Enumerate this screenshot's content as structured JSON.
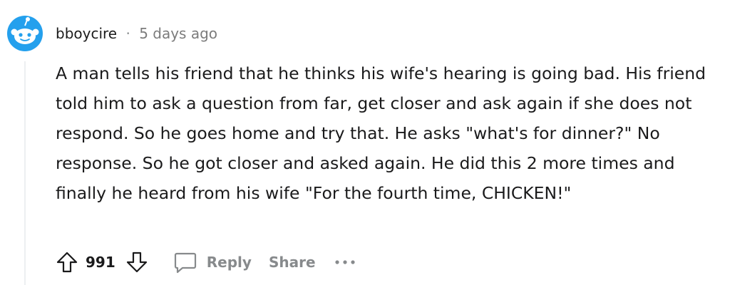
{
  "comment": {
    "author": "bboycire",
    "separator": "·",
    "time_ago": "5 days ago",
    "body": "A man tells his friend that he thinks his wife's hearing is going bad. His friend told him to ask a question from far, get closer and ask again if she does not respond. So he goes home and try that. He asks \"what's for dinner?\" No response. So he got closer and asked again. He did this 2 more times and finally he heard from his wife \"For the fourth time, CHICKEN!\"",
    "score": "991",
    "actions": {
      "reply_label": "Reply",
      "share_label": "Share",
      "more_label": "•••"
    },
    "icons": {
      "avatar": "snoo-avatar-icon",
      "upvote": "upvote-arrow-icon",
      "downvote": "downvote-arrow-icon",
      "reply": "speech-bubble-icon",
      "more": "more-options-icon"
    },
    "colors": {
      "text": "#1a1a1b",
      "muted": "#878a8c",
      "avatar_bg": "#24a0ed",
      "thread_line": "#edeff1"
    }
  }
}
